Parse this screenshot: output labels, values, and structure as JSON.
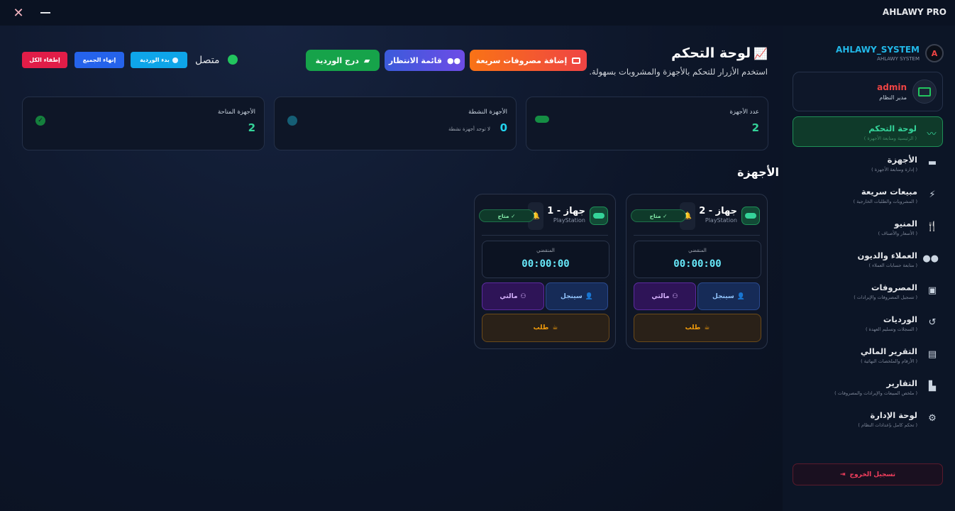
{
  "window": {
    "title": "AHLAWY PRO",
    "close_icon": "close-icon",
    "minimize_icon": "minimize-icon"
  },
  "sidebar": {
    "brand_name": "AHLAWY_SYSTEM",
    "brand_sub": "AHLAWY SYSTEM",
    "user": {
      "name": "admin",
      "role": "مدير النظام"
    },
    "items": [
      {
        "label": "لوحة التحكم",
        "sub": "( الرئيسية ومتابعة الأجهزة )",
        "icon": "chart-line-icon",
        "active": true
      },
      {
        "label": "الأجهزة",
        "sub": "( إدارة ومتابعة الأجهزة )",
        "icon": "gamepad-icon"
      },
      {
        "label": "مبيعات سريعة",
        "sub": "( المشروبات والطلبات الخارجية )",
        "icon": "bolt-icon"
      },
      {
        "label": "المنيو",
        "sub": "( الأسعار والأصناف )",
        "icon": "utensils-icon"
      },
      {
        "label": "العملاء والديون",
        "sub": "( متابعة حسابات العملاء )",
        "icon": "users-icon"
      },
      {
        "label": "المصروفات",
        "sub": "( تسجيل المصروفات والإيرادات )",
        "icon": "money-icon"
      },
      {
        "label": "الورديات",
        "sub": "( السجلات وتسليم العهدة )",
        "icon": "history-icon"
      },
      {
        "label": "التقرير المالي",
        "sub": "( الأرقام والملخصات النهائية )",
        "icon": "report-card-icon"
      },
      {
        "label": "التقارير",
        "sub": "( ملخص المبيعات والإيرادات والمصروفات )",
        "icon": "bar-chart-icon"
      },
      {
        "label": "لوحة الإدارة",
        "sub": "( تحكم كامل بإعدادات النظام )",
        "icon": "users-gear-icon"
      }
    ],
    "logout_label": "تسجيل الخروج"
  },
  "header": {
    "title": "لوحة التحكم",
    "description": "استخدم الأزرار للتحكم بالأجهزة والمشروبات بسهولة.",
    "buttons": {
      "expense": "إضافة مصروفات سريعة",
      "queue": "قائمة الانتظار",
      "drawer": "درج الوردية"
    },
    "status_label": "متصل",
    "shift_start": "بدء الوردية",
    "end_all": "إنهاء الجميع",
    "power_off_all": "إطفاء الكل"
  },
  "stats": [
    {
      "label": "عدد الأجهزة",
      "value": "2",
      "icon": "gamepad-icon"
    },
    {
      "label": "الأجهزة النشطة",
      "value": "0",
      "note": "لا توجد أجهزة نشطة",
      "icon": "clock-icon"
    },
    {
      "label": "الأجهزة المتاحة",
      "value": "2",
      "icon": "check-circle-icon"
    }
  ],
  "devices_section_title": "الأجهزة",
  "devices": [
    {
      "name": "جهاز - 2",
      "type": "PlayStation",
      "status": "✓ متاح",
      "timer_label": "المنقضي",
      "timer": "00:00:00",
      "single": "سينجل",
      "multi": "مالتي",
      "order": "طلب"
    },
    {
      "name": "جهاز - 1",
      "type": "PlayStation",
      "status": "✓ متاح",
      "timer_label": "المنقضي",
      "timer": "00:00:00",
      "single": "سينجل",
      "multi": "مالتي",
      "order": "طلب"
    }
  ],
  "colors": {
    "accent": "#34d399",
    "danger": "#e11d48",
    "primary": "#2563eb"
  }
}
